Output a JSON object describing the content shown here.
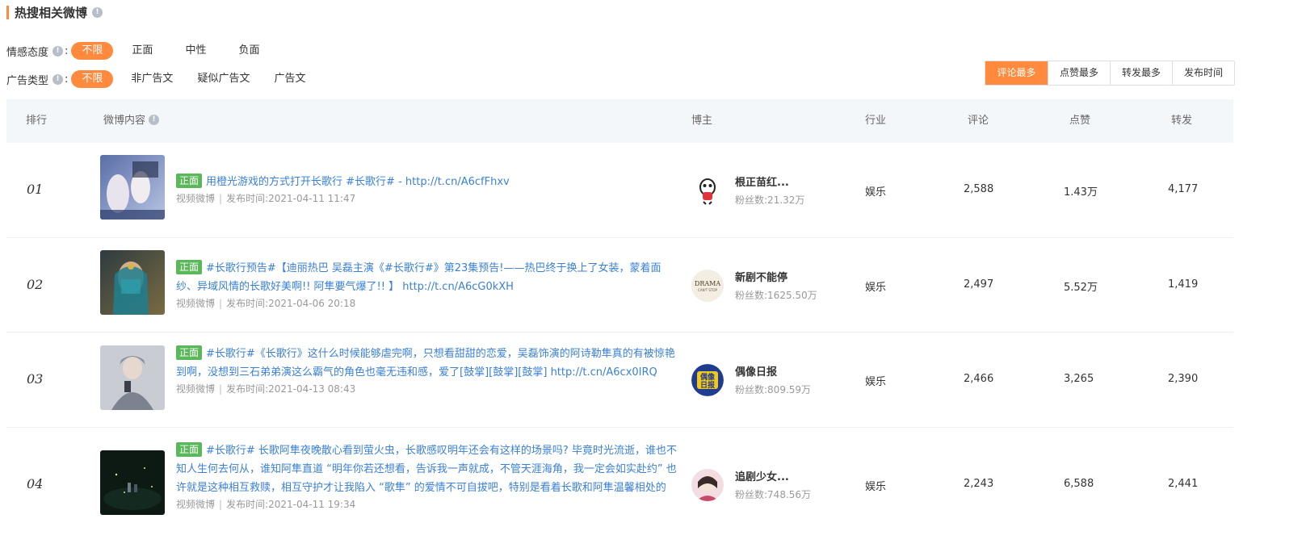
{
  "section": {
    "title": "热搜相关微博"
  },
  "filters": {
    "sentiment": {
      "label": "情感态度",
      "colon": ":",
      "options": [
        "不限",
        "正面",
        "中性",
        "负面"
      ],
      "selected": "不限"
    },
    "ad_type": {
      "label": "广告类型",
      "colon": ":",
      "options": [
        "不限",
        "非广告文",
        "疑似广告文",
        "广告文"
      ],
      "selected": "不限"
    }
  },
  "sort": {
    "options": [
      "评论最多",
      "点赞最多",
      "转发最多",
      "发布时间"
    ],
    "selected": "评论最多"
  },
  "table": {
    "headers": {
      "rank": "排行",
      "content": "微博内容",
      "author": "博主",
      "industry": "行业",
      "comments": "评论",
      "likes": "点赞",
      "reposts": "转发"
    },
    "rows": [
      {
        "rank": "01",
        "tag": "正面",
        "text": "用橙光游戏的方式打开长歌行 #长歌行# - http://t.cn/A6cfFhxv",
        "source": "视频微博",
        "publish_label": "发布时间:",
        "publish_time": "2021-04-11 11:47",
        "author": "根正苗红...",
        "fans_label": "粉丝数:",
        "fans": "21.32万",
        "industry": "娱乐",
        "comments": "2,588",
        "likes": "1.43万",
        "reposts": "4,177"
      },
      {
        "rank": "02",
        "tag": "正面",
        "text": "#长歌行预告#【迪丽热巴 吴磊主演《#长歌行#》第23集预告!——热巴终于换上了女装，蒙着面纱、异域风情的长歌好美啊!! 阿隼要气爆了!! 】 http://t.cn/A6cG0kXH",
        "source": "视频微博",
        "publish_label": "发布时间:",
        "publish_time": "2021-04-06 20:18",
        "author": "新剧不能停",
        "fans_label": "粉丝数:",
        "fans": "1625.50万",
        "industry": "娱乐",
        "comments": "2,497",
        "likes": "5.52万",
        "reposts": "1,419"
      },
      {
        "rank": "03",
        "tag": "正面",
        "text": "#长歌行#《长歌行》这什么时候能够虐完啊，只想看甜甜的恋爱，吴磊饰演的阿诗勒隼真的有被惊艳到啊，没想到三石弟弟演这么霸气的角色也毫无违和感，爱了[鼓掌][鼓掌][鼓掌] http://t.cn/A6cx0IRQ",
        "source": "视频微博",
        "publish_label": "发布时间:",
        "publish_time": "2021-04-13 08:43",
        "author": "偶像日报",
        "fans_label": "粉丝数:",
        "fans": "809.59万",
        "industry": "娱乐",
        "comments": "2,466",
        "likes": "3,265",
        "reposts": "2,390"
      },
      {
        "rank": "04",
        "tag": "正面",
        "text": "#长歌行# 长歌阿隼夜晚散心看到萤火虫，长歌感叹明年还会有这样的场景吗? 毕竟时光流逝，谁也不知人生何去何从，谁知阿隼直道 “明年你若还想看，告诉我一声就成，不管天涯海角，我一定会如实赴约” 也许就是这种相互救赎，相互守护才让我陷入 “歌隼” 的爱情不可自拔吧，特别是看着长歌和阿隼温馨相处的",
        "source": "视频微博",
        "publish_label": "发布时间:",
        "publish_time": "2021-04-11 19:34",
        "author": "追剧少女...",
        "fans_label": "粉丝数:",
        "fans": "748.56万",
        "industry": "娱乐",
        "comments": "2,243",
        "likes": "6,588",
        "reposts": "2,441"
      }
    ]
  },
  "avatar_texts": {
    "drama_1": "DRAMA",
    "drama_2": "CAN'T STOP",
    "idol_1": "偶像",
    "idol_2": "日报"
  },
  "colors": {
    "accent": "#ff8a3d",
    "link": "#3a80d6",
    "tag_positive": "#5ab75a",
    "header_bg": "#f4f7fa"
  }
}
